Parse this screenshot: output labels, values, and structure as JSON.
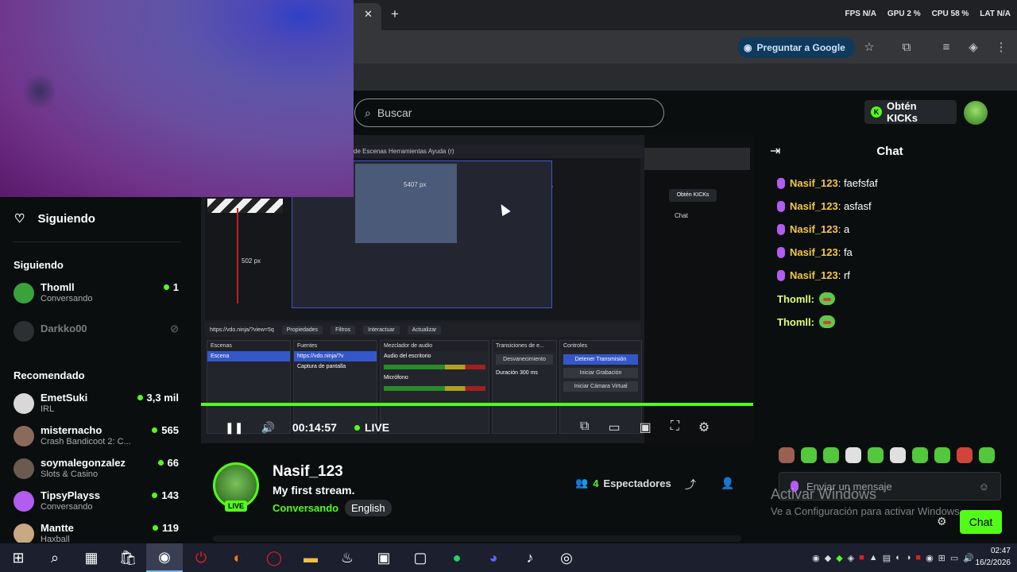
{
  "browser": {
    "perf": [
      "FPS N/A",
      "GPU 2 %",
      "CPU 58 %",
      "LAT N/A"
    ],
    "ask_google": "Preguntar a Google"
  },
  "kick": {
    "search_placeholder": "Buscar",
    "kicks_button": "Obtén KICKs"
  },
  "sidebar": {
    "following_header": "Siguiendo",
    "following_section": "Siguiendo",
    "following": [
      {
        "name": "Thomll",
        "sub": "Conversando",
        "viewers": "1",
        "live": true,
        "color": "#3aa23a"
      },
      {
        "name": "Darkko00",
        "sub": "",
        "viewers": "",
        "live": false,
        "color": "#555a5e"
      }
    ],
    "recommended_section": "Recomendado",
    "recommended": [
      {
        "name": "EmetSuki",
        "sub": "IRL",
        "viewers": "3,3 mil",
        "color": "#d8d8d8"
      },
      {
        "name": "misternacho",
        "sub": "Crash Bandicoot 2: C...",
        "viewers": "565",
        "color": "#8a6a5a"
      },
      {
        "name": "soymalegonzalez",
        "sub": "Slots & Casino",
        "viewers": "66",
        "color": "#6a5a50"
      },
      {
        "name": "TipsyPlayss",
        "sub": "Conversando",
        "viewers": "143",
        "color": "#b25cf0"
      },
      {
        "name": "Mantte",
        "sub": "Haxball",
        "viewers": "119",
        "color": "#c8a880"
      }
    ]
  },
  "player": {
    "time": "00:14:57",
    "live_label": "LIVE",
    "obs_menu": "de Escenas   Herramientas   Ayuda (r)",
    "obs_props": [
      "https://vdo.ninja/?view=5q",
      "Propiedades",
      "Filtros",
      "Interactuar",
      "Actualizar"
    ],
    "obs_panels": {
      "scenes_title": "Escenas",
      "scene_item": "Escena",
      "sources_title": "Fuentes",
      "sources": [
        "https://vdo.ninja/?v",
        "Captura de pantalla"
      ],
      "mixer_title": "Mezclador de audio",
      "mixer_items": [
        "Audio del escritorio",
        "Micrófono"
      ],
      "transitions_title": "Transiciones de e...",
      "transition_value": "Desvanecimiento",
      "duration_label": "Duración",
      "duration_value": "300 ms",
      "controls_title": "Controles",
      "controls": [
        "Detener Transmisión",
        "Iniciar Grabación",
        "Iniciar Cámara Virtual"
      ]
    },
    "obs_ps": "502 px",
    "obs_ps2": "5407 px",
    "mirror_kicks": "Obtén KICKs",
    "mirror_chat": "Chat"
  },
  "streamer": {
    "name": "Nasif_123",
    "title": "My first stream.",
    "category": "Conversando",
    "language": "English",
    "live_badge": "LIVE",
    "viewers_count": "4",
    "viewers_label": "Espectadores"
  },
  "chat": {
    "title": "Chat",
    "messages": [
      {
        "user": "Nasif_123",
        "text": ": faefsfaf"
      },
      {
        "user": "Nasif_123",
        "text": ": asfasf"
      },
      {
        "user": "Nasif_123",
        "text": ": a"
      },
      {
        "user": "Nasif_123",
        "text": ": fa"
      },
      {
        "user": "Nasif_123",
        "text": ": rf"
      }
    ],
    "emote_messages": [
      {
        "user": "Thomll:"
      },
      {
        "user": "Thomll:"
      }
    ],
    "input_placeholder": "Enviar un mensaje",
    "send_label": "Chat"
  },
  "watermark": {
    "title": "Activar Windows",
    "subtitle": "Ve a Configuración para activar Windows."
  },
  "taskbar": {
    "time": "02:47",
    "date": "16/2/2026"
  },
  "colors": {
    "kick_green": "#53fc18",
    "chat_user": "#f5c842",
    "badge_purple": "#b25cf0"
  }
}
